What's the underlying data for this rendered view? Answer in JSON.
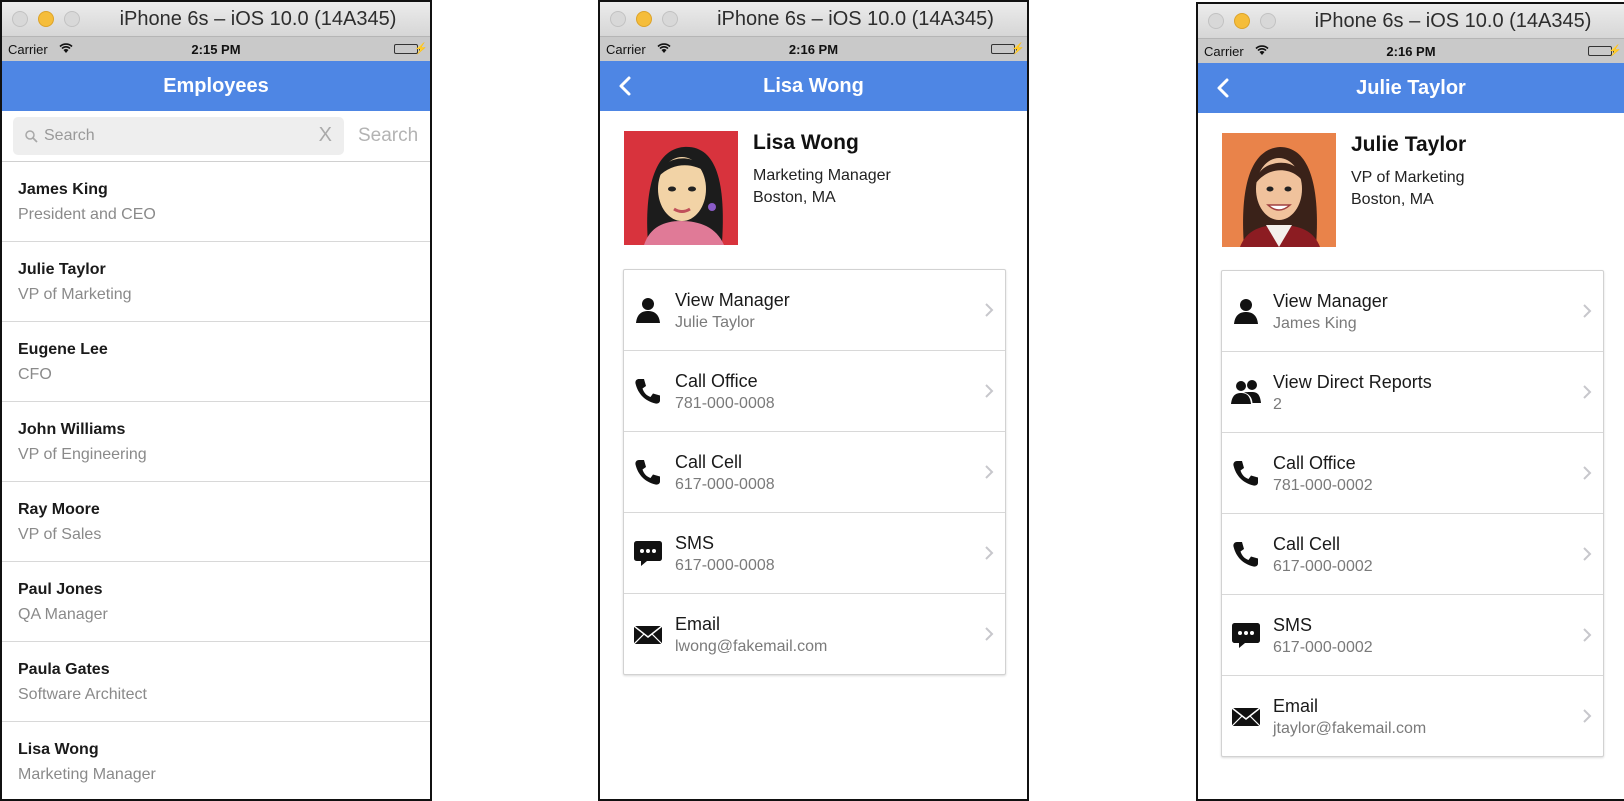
{
  "windows": [
    {
      "title": "iPhone 6s – iOS 10.0 (14A345)",
      "status": {
        "carrier": "Carrier",
        "time": "2:15 PM"
      },
      "nav_title": "Employees",
      "search": {
        "placeholder": "Search",
        "clear": "X",
        "button": "Search"
      },
      "employees": [
        {
          "name": "James King",
          "title": "President and CEO"
        },
        {
          "name": "Julie Taylor",
          "title": "VP of Marketing"
        },
        {
          "name": "Eugene Lee",
          "title": "CFO"
        },
        {
          "name": "John Williams",
          "title": "VP of Engineering"
        },
        {
          "name": "Ray Moore",
          "title": "VP of Sales"
        },
        {
          "name": "Paul Jones",
          "title": "QA Manager"
        },
        {
          "name": "Paula Gates",
          "title": "Software Architect"
        },
        {
          "name": "Lisa Wong",
          "title": "Marketing Manager"
        }
      ]
    },
    {
      "title": "iPhone 6s – iOS 10.0 (14A345)",
      "status": {
        "carrier": "Carrier",
        "time": "2:16 PM"
      },
      "nav_title": "Lisa Wong",
      "profile": {
        "name": "Lisa Wong",
        "title": "Marketing Manager",
        "location": "Boston, MA",
        "photo_colors": {
          "bg": "#d8333d",
          "skin": "#f2d3a6",
          "hair": "#1c1c1c",
          "shirt": "#e07a97"
        }
      },
      "actions": [
        {
          "icon": "person-icon",
          "label": "View Manager",
          "value": "Julie Taylor"
        },
        {
          "icon": "phone-icon",
          "label": "Call Office",
          "value": "781-000-0008"
        },
        {
          "icon": "phone-icon",
          "label": "Call Cell",
          "value": "617-000-0008"
        },
        {
          "icon": "sms-icon",
          "label": "SMS",
          "value": "617-000-0008"
        },
        {
          "icon": "mail-icon",
          "label": "Email",
          "value": "lwong@fakemail.com"
        }
      ]
    },
    {
      "title": "iPhone 6s – iOS 10.0 (14A345)",
      "status": {
        "carrier": "Carrier",
        "time": "2:16 PM"
      },
      "nav_title": "Julie Taylor",
      "profile": {
        "name": "Julie Taylor",
        "title": "VP of Marketing",
        "location": "Boston, MA",
        "photo_colors": {
          "bg": "#e9834a",
          "skin": "#f0c29c",
          "hair": "#3a2219",
          "shirt": "#8c1c22"
        }
      },
      "actions": [
        {
          "icon": "person-icon",
          "label": "View Manager",
          "value": "James King"
        },
        {
          "icon": "group-icon",
          "label": "View Direct Reports",
          "value": "2"
        },
        {
          "icon": "phone-icon",
          "label": "Call Office",
          "value": "781-000-0002"
        },
        {
          "icon": "phone-icon",
          "label": "Call Cell",
          "value": "617-000-0002"
        },
        {
          "icon": "sms-icon",
          "label": "SMS",
          "value": "617-000-0002"
        },
        {
          "icon": "mail-icon",
          "label": "Email",
          "value": "jtaylor@fakemail.com"
        }
      ]
    }
  ],
  "colors": {
    "nav_blue": "#4e86e4",
    "traffic_yellow": "#f5bd3a",
    "battery_green": "#4cd964"
  }
}
